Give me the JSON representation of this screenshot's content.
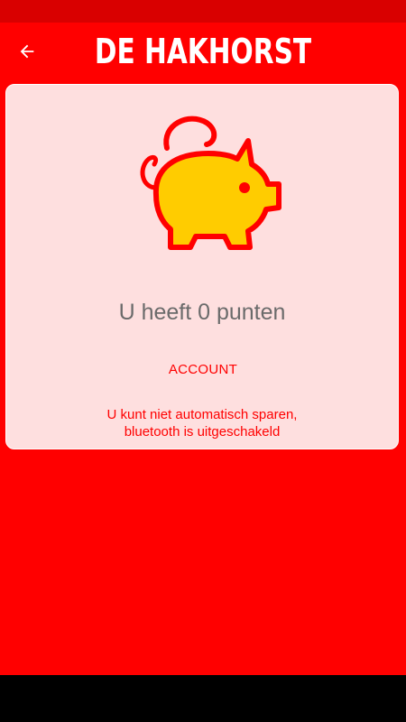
{
  "app": {
    "title": "DE HAKHORST"
  },
  "card": {
    "points_text": "U heeft 0 punten",
    "account_label": "ACCOUNT",
    "message_line1": "U kunt niet automatisch sparen,",
    "message_line2": "bluetooth is uitgeschakeld"
  },
  "icons": {
    "back": "arrow-left-icon",
    "savings": "piggy-bank-icon"
  },
  "colors": {
    "background": "#ff0000",
    "status_bar": "#d90000",
    "card": "#fedfdf",
    "piggy_fill": "#ffcc00",
    "accent_text": "#ff0000",
    "points_text": "#6b6b6b"
  }
}
